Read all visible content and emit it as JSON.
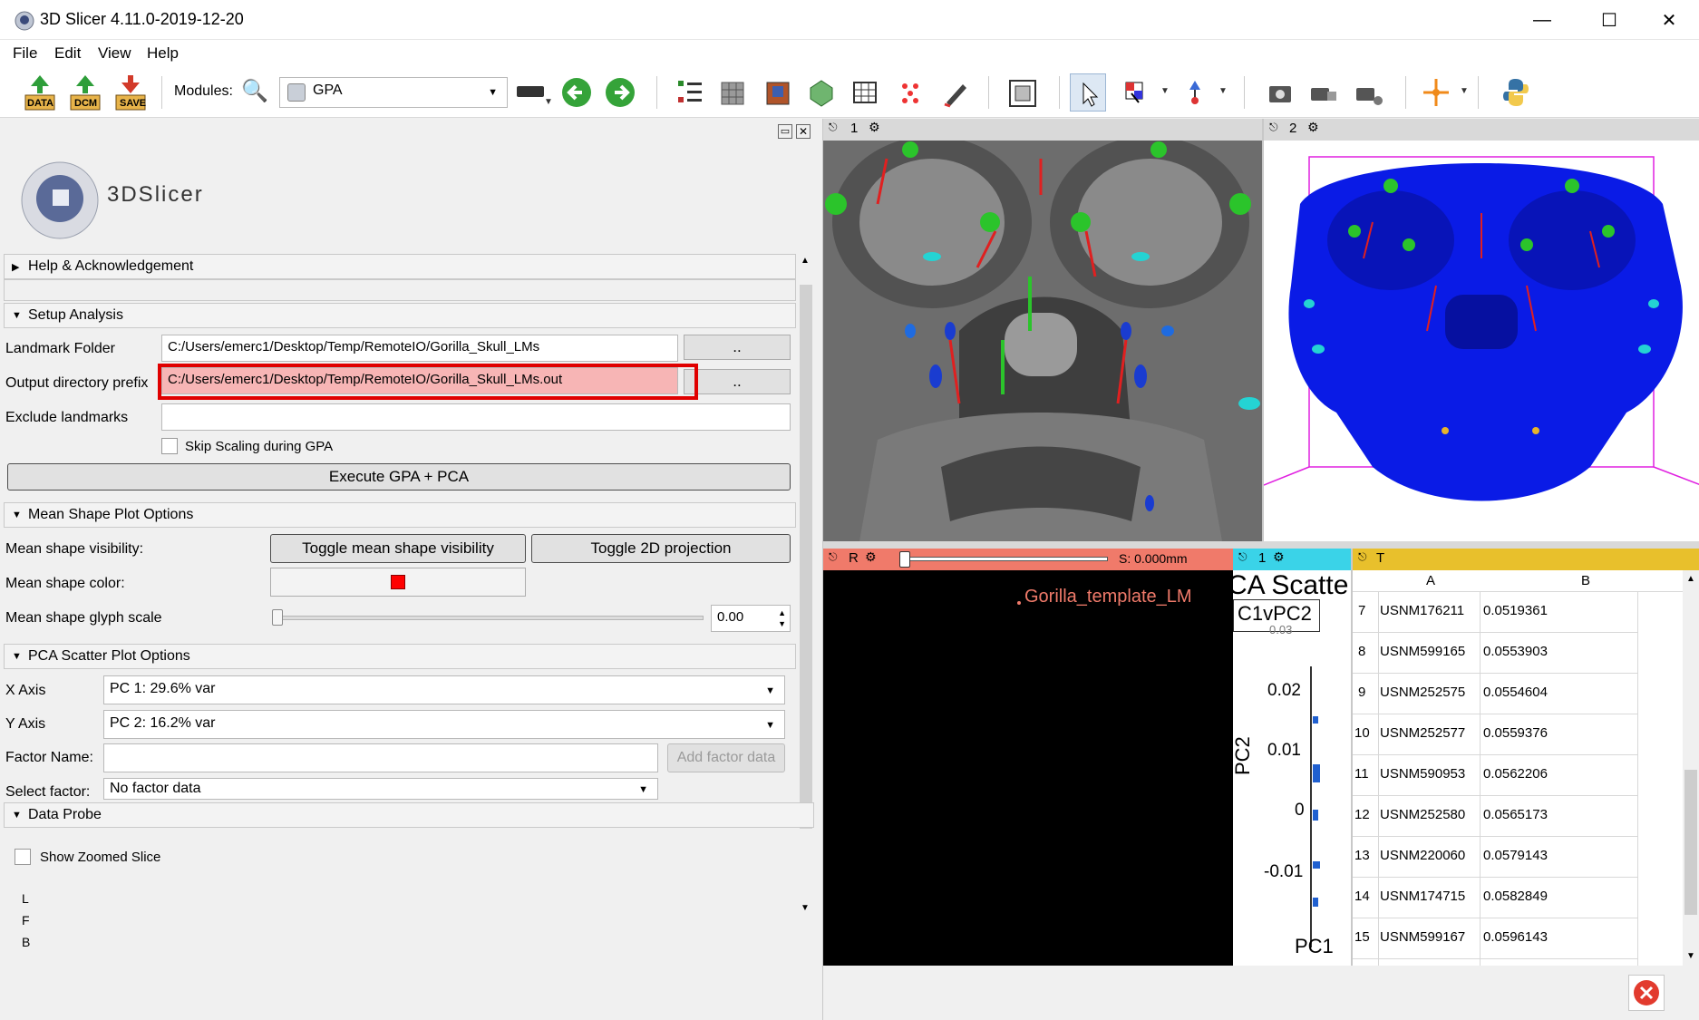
{
  "window": {
    "title": "3D Slicer 4.11.0-2019-12-20"
  },
  "menu": [
    "File",
    "Edit",
    "View",
    "Help"
  ],
  "toolbar": {
    "modules_label": "Modules:",
    "module_selected": "GPA",
    "data_label": "DATA",
    "dcm_label": "DCM",
    "save_label": "SAVE"
  },
  "logo": {
    "text": "3DSlicer"
  },
  "sections": {
    "help": "Help & Acknowledgement",
    "setup": "Setup Analysis",
    "mean_shape": "Mean Shape Plot Options",
    "pca": "PCA Scatter Plot Options",
    "probe": "Data Probe"
  },
  "setup": {
    "landmark_folder_label": "Landmark Folder",
    "landmark_folder_value": "C:/Users/emerc1/Desktop/Temp/RemoteIO/Gorilla_Skull_LMs",
    "output_prefix_label": "Output directory prefix",
    "output_prefix_value": "C:/Users/emerc1/Desktop/Temp/RemoteIO/Gorilla_Skull_LMs.out",
    "browse_label": "..",
    "exclude_label": "Exclude landmarks",
    "exclude_value": "",
    "skip_scaling_label": "Skip Scaling during GPA",
    "execute_label": "Execute GPA + PCA"
  },
  "mean_shape": {
    "visibility_label": "Mean shape visibility:",
    "toggle_visibility_label": "Toggle mean shape visibility",
    "toggle_2d_label": "Toggle 2D projection",
    "color_label": "Mean shape color:",
    "color_value": "#ff0000",
    "glyph_label": "Mean shape glyph scale",
    "glyph_value": "0.00"
  },
  "pca": {
    "x_label": "X Axis",
    "x_value": "PC 1: 29.6% var",
    "y_label": "Y Axis",
    "y_value": "PC 2: 16.2% var",
    "factor_name_label": "Factor Name:",
    "factor_name_value": "",
    "add_factor_label": "Add factor data",
    "select_factor_label": "Select factor:",
    "select_factor_value": "No factor data"
  },
  "probe": {
    "zoom_label": "Show Zoomed Slice",
    "letters": [
      "L",
      "F",
      "B"
    ]
  },
  "views": {
    "view1_label": "1",
    "view2_label": "2",
    "slice_label": "R",
    "slice_offset": "S: 0.000mm",
    "slice_annotation": "Gorilla_template_LM",
    "plot_label": "1",
    "table_label": "T",
    "plot_title": "CA Scatte",
    "plot_tab": "C1vPC2",
    "plot_ylabel": "PC2",
    "plot_xlabel": "PC1",
    "plot_yticks": [
      "0.02",
      "0.01",
      "0",
      "-0.01"
    ],
    "plot_cut_tick": "0.03"
  },
  "colors": {
    "slice_red": "#f07a6a",
    "plot_cyan": "#3ad3e8",
    "table_gold": "#e8c02c",
    "highlight_red": "#e00000",
    "model_blue": "#0a1be6"
  },
  "table": {
    "columns": [
      "A",
      "B"
    ],
    "rows": [
      {
        "n": "7",
        "a": "USNM176211",
        "b": "0.0519361"
      },
      {
        "n": "8",
        "a": "USNM599165",
        "b": "0.0553903"
      },
      {
        "n": "9",
        "a": "USNM252575",
        "b": "0.0554604"
      },
      {
        "n": "10",
        "a": "USNM252577",
        "b": "0.0559376"
      },
      {
        "n": "11",
        "a": "USNM590953",
        "b": "0.0562206"
      },
      {
        "n": "12",
        "a": "USNM252580",
        "b": "0.0565173"
      },
      {
        "n": "13",
        "a": "USNM220060",
        "b": "0.0579143"
      },
      {
        "n": "14",
        "a": "USNM174715",
        "b": "0.0582849"
      },
      {
        "n": "15",
        "a": "USNM599167",
        "b": "0.0596143"
      }
    ]
  }
}
